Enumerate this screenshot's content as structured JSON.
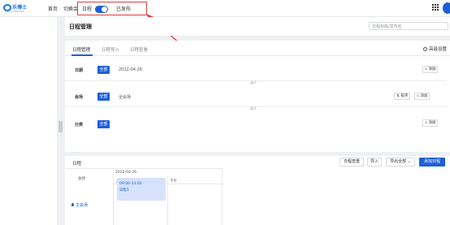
{
  "topbar": {
    "logo_text": "乐博士",
    "logo_sub": "BOSHI MEETING",
    "nav_home": "首页",
    "nav_switch": "切换会议",
    "toggle_left": "日程",
    "toggle_right": "已发布"
  },
  "main": {
    "page_title": "日程管理",
    "search_placeholder": "日程标题/发布名"
  },
  "tabs": [
    "日程管理",
    "日程导入",
    "日程查看"
  ],
  "advanced_settings": "高级设置",
  "rows": {
    "date": {
      "label": "日期",
      "all_button": "全部",
      "value": "2022-04-26",
      "add_button": "添加"
    },
    "expand_1": "展开",
    "venue": {
      "label": "会场",
      "all_button": "全部",
      "value": "全会场",
      "sort_button": "排序",
      "add_button": "添加"
    },
    "expand_2": "展开",
    "topic": {
      "label": "分类",
      "all_button": "全部",
      "add_button": "添加"
    }
  },
  "schedule": {
    "title": "日程",
    "buttons": [
      "日程查重",
      "导入",
      "导出全部",
      "添加日程"
    ],
    "venue_header": "会场",
    "date": "2022-04-26",
    "morning": "上午",
    "afternoon": "下午",
    "venue_name": "主会场",
    "event_time": "09:00-14:00",
    "event_name": "日程1"
  },
  "colors": {
    "accent": "#1e5fd6",
    "highlight_border": "#e23a3a"
  }
}
